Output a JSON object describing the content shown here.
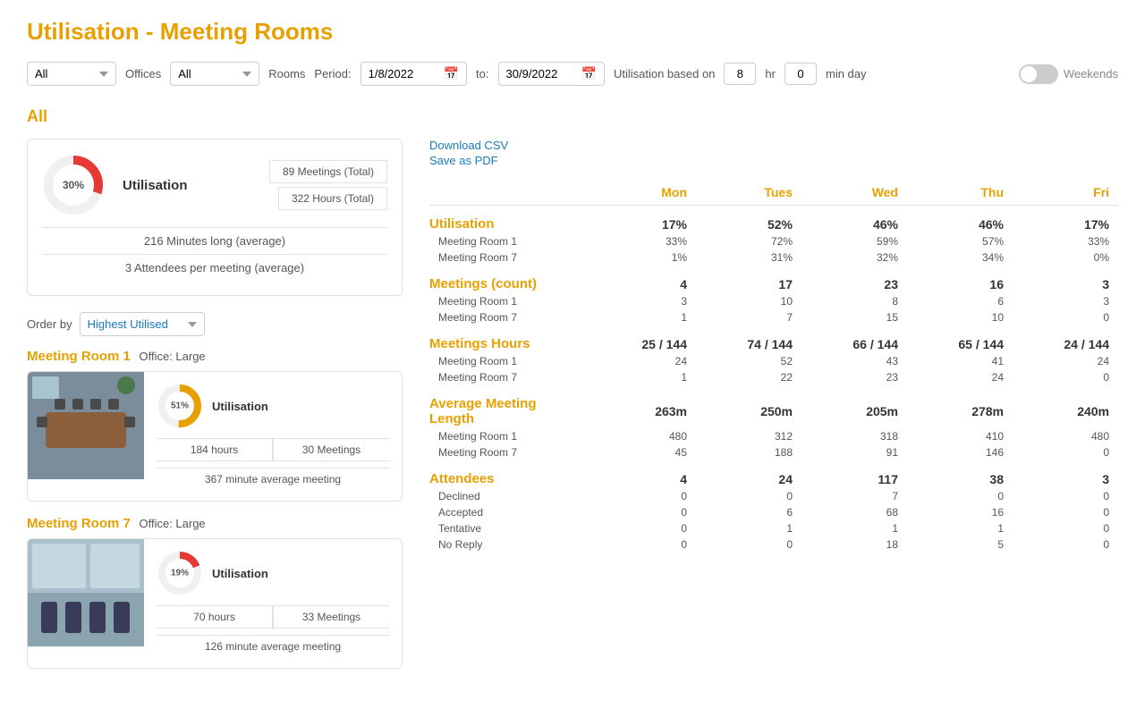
{
  "page": {
    "title": "Utilisation - Meeting Rooms"
  },
  "filters": {
    "filter1_value": "All",
    "offices_label": "Offices",
    "filter2_value": "All",
    "rooms_label": "Rooms",
    "period_label": "Period:",
    "date_from": "1/8/2022",
    "date_to_label": "to:",
    "date_to": "30/9/2022",
    "util_label": "Utilisation based on",
    "hr_value": "8",
    "hr_label": "hr",
    "min_value": "0",
    "min_label": "min day",
    "weekends_label": "Weekends"
  },
  "all_section": {
    "title": "All",
    "summary": {
      "utilisation_pct": "30%",
      "util_label": "Utilisation",
      "meetings_total": "89 Meetings (Total)",
      "hours_total": "322 Hours (Total)",
      "minutes_avg": "216 Minutes long (average)",
      "attendees_avg": "3 Attendees per meeting (average)"
    }
  },
  "order_by": {
    "label": "Order by",
    "value": "Highest Utilised"
  },
  "rooms": [
    {
      "name": "Meeting Room 1",
      "office_label": "Office:",
      "office": "Large",
      "util_pct": "51%",
      "util_label": "Utilisation",
      "hours": "184 hours",
      "meetings": "30 Meetings",
      "avg_meeting": "367 minute average meeting",
      "donut_color": "#e8a000",
      "donut_pct": 51
    },
    {
      "name": "Meeting Room 7",
      "office_label": "Office:",
      "office": "Large",
      "util_pct": "19%",
      "util_label": "Utilisation",
      "hours": "70 hours",
      "meetings": "33 Meetings",
      "avg_meeting": "126 minute average meeting",
      "donut_color": "#e53935",
      "donut_pct": 19
    }
  ],
  "links": {
    "download_csv": "Download CSV",
    "save_pdf": "Save as PDF"
  },
  "table": {
    "headers": [
      "",
      "Mon",
      "Tues",
      "Wed",
      "Thu",
      "Fri"
    ],
    "sections": [
      {
        "name": "Utilisation",
        "values": [
          "17%",
          "52%",
          "46%",
          "46%",
          "17%"
        ],
        "sub_rows": [
          {
            "label": "Meeting Room 1",
            "values": [
              "33%",
              "72%",
              "59%",
              "57%",
              "33%"
            ]
          },
          {
            "label": "Meeting Room 7",
            "values": [
              "1%",
              "31%",
              "32%",
              "34%",
              "0%"
            ]
          }
        ]
      },
      {
        "name": "Meetings (count)",
        "values": [
          "4",
          "17",
          "23",
          "16",
          "3"
        ],
        "sub_rows": [
          {
            "label": "Meeting Room 1",
            "values": [
              "3",
              "10",
              "8",
              "6",
              "3"
            ]
          },
          {
            "label": "Meeting Room 7",
            "values": [
              "1",
              "7",
              "15",
              "10",
              "0"
            ]
          }
        ]
      },
      {
        "name": "Meetings Hours",
        "values": [
          "25 / 144",
          "74 / 144",
          "66 / 144",
          "65 / 144",
          "24 / 144"
        ],
        "sub_rows": [
          {
            "label": "Meeting Room 1",
            "values": [
              "24",
              "52",
              "43",
              "41",
              "24"
            ]
          },
          {
            "label": "Meeting Room 7",
            "values": [
              "1",
              "22",
              "23",
              "24",
              "0"
            ]
          }
        ]
      },
      {
        "name": "Average Meeting Length",
        "values": [
          "263m",
          "250m",
          "205m",
          "278m",
          "240m"
        ],
        "sub_rows": [
          {
            "label": "Meeting Room 1",
            "values": [
              "480",
              "312",
              "318",
              "410",
              "480"
            ]
          },
          {
            "label": "Meeting Room 7",
            "values": [
              "45",
              "188",
              "91",
              "146",
              "0"
            ]
          }
        ]
      },
      {
        "name": "Attendees",
        "values": [
          "4",
          "24",
          "117",
          "38",
          "3"
        ],
        "sub_rows": [
          {
            "label": "Declined",
            "values": [
              "0",
              "0",
              "7",
              "0",
              "0"
            ]
          },
          {
            "label": "Accepted",
            "values": [
              "0",
              "6",
              "68",
              "16",
              "0"
            ]
          },
          {
            "label": "Tentative",
            "values": [
              "0",
              "1",
              "1",
              "1",
              "0"
            ]
          },
          {
            "label": "No Reply",
            "values": [
              "0",
              "0",
              "18",
              "5",
              "0"
            ]
          }
        ]
      }
    ]
  }
}
